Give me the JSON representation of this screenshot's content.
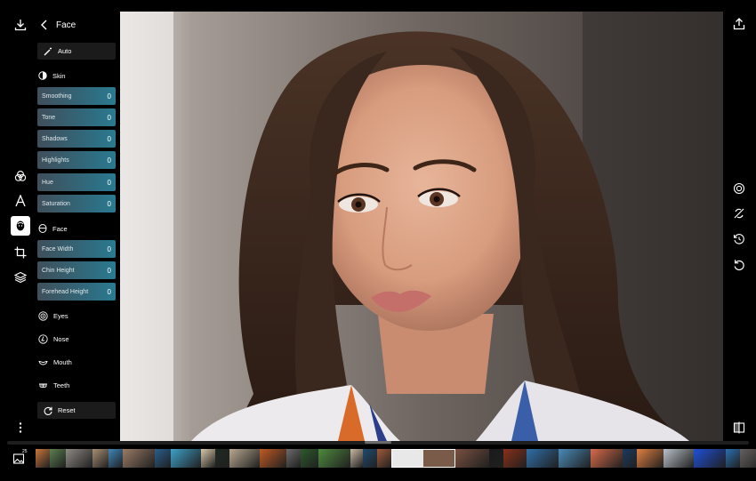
{
  "header": {
    "title": "Face"
  },
  "panel": {
    "auto_label": "Auto",
    "skin_label": "Skin",
    "skin_sliders": [
      {
        "label": "Smoothing",
        "value": "0"
      },
      {
        "label": "Tone",
        "value": "0"
      },
      {
        "label": "Shadows",
        "value": "0"
      },
      {
        "label": "Highlights",
        "value": "0"
      },
      {
        "label": "Hue",
        "value": "0"
      },
      {
        "label": "Saturation",
        "value": "0"
      }
    ],
    "face_label": "Face",
    "face_sliders": [
      {
        "label": "Face Width",
        "value": "0"
      },
      {
        "label": "Chin Height",
        "value": "0"
      },
      {
        "label": "Forehead Height",
        "value": "0"
      }
    ],
    "eyes_label": "Eyes",
    "nose_label": "Nose",
    "mouth_label": "Mouth",
    "teeth_label": "Teeth",
    "reset_label": "Reset"
  },
  "filmstrip": {
    "count_badge": "25",
    "thumb_colors": [
      "#c8763a",
      "#5b7f4f",
      "#8e8a84",
      "#a78f73",
      "#3f86b8",
      "#9a7b64",
      "#285f8c",
      "#3ea1c8",
      "#d8c8a8",
      "#1e2a22",
      "#b8a890",
      "#c05a22",
      "#6b6b6b",
      "#2c5a2c",
      "#4e8a3e",
      "#c9b9a5",
      "#204a70",
      "#a05a38",
      "#d6d6d6",
      "#7a5040",
      "#1a1a1a",
      "#8a3018",
      "#2f6fa8",
      "#4a8ab8",
      "#d86a4a",
      "#1c3a5c",
      "#e08040",
      "#b8c0c8",
      "#1e4fd8",
      "#2a70b0",
      "#666060"
    ]
  },
  "colors": {
    "slider_start": "#3f4f5a",
    "slider_end": "#2a7a90",
    "panel_bg": "#000000"
  }
}
